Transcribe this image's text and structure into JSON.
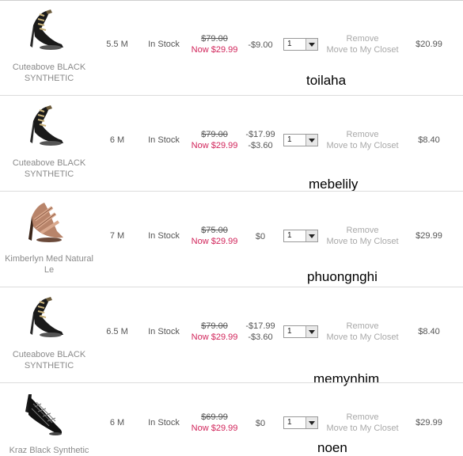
{
  "cart": {
    "items": [
      {
        "name": "Cuteabove BLACK SYNTHETIC",
        "size": "5.5 M",
        "stock": "In Stock",
        "original_price": "$79.00",
        "now_price": "Now $29.99",
        "discounts": [
          "-$9.00"
        ],
        "quantity": "1",
        "remove_label": "Remove",
        "move_label": "Move to My Closet",
        "total": "$20.99",
        "username": "toilaha"
      },
      {
        "name": "Cuteabove BLACK SYNTHETIC",
        "size": "6 M",
        "stock": "In Stock",
        "original_price": "$79.00",
        "now_price": "Now $29.99",
        "discounts": [
          "-$17.99",
          "-$3.60"
        ],
        "quantity": "1",
        "remove_label": "Remove",
        "move_label": "Move to My Closet",
        "total": "$8.40",
        "username": "mebelily"
      },
      {
        "name": "Kimberlyn Med Natural Le",
        "size": "7 M",
        "stock": "In Stock",
        "original_price": "$75.00",
        "now_price": "Now $29.99",
        "discounts": [
          "$0"
        ],
        "quantity": "1",
        "remove_label": "Remove",
        "move_label": "Move to My Closet",
        "total": "$29.99",
        "username": "phuongnghi"
      },
      {
        "name": "Cuteabove BLACK SYNTHETIC",
        "size": "6.5 M",
        "stock": "In Stock",
        "original_price": "$79.00",
        "now_price": "Now $29.99",
        "discounts": [
          "-$17.99",
          "-$3.60"
        ],
        "quantity": "1",
        "remove_label": "Remove",
        "move_label": "Move to My Closet",
        "total": "$8.40",
        "username": "memynhim"
      },
      {
        "name": "Kraz Black Synthetic",
        "size": "6 M",
        "stock": "In Stock",
        "original_price": "$69.99",
        "now_price": "Now $29.99",
        "discounts": [
          "$0"
        ],
        "quantity": "1",
        "remove_label": "Remove",
        "move_label": "Move to My Closet",
        "total": "$29.99",
        "username": "noen"
      }
    ]
  },
  "colors": {
    "now_price": "#d1245a",
    "muted_text": "#a9a9a9",
    "separator": "#dcdcdc"
  },
  "icons": [
    "strappy-sandal-black",
    "strappy-sandal-natural",
    "pump-heel-black",
    "dropdown-arrow-icon"
  ]
}
